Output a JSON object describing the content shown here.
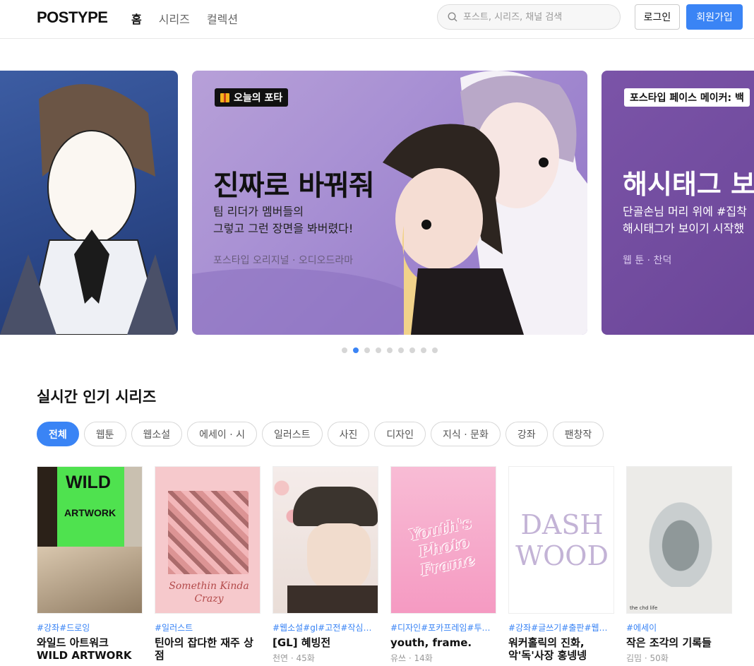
{
  "header": {
    "logo": "POSTYPE",
    "nav": [
      "홈",
      "시리즈",
      "컬렉션"
    ],
    "search_placeholder": "포스트, 시리즈, 채널 검색",
    "login": "로그인",
    "signup": "회원가입"
  },
  "carousel": {
    "main": {
      "badge": "오늘의 포타",
      "title": "진짜로 바꿔줘",
      "desc_line1": "팀 리더가 멤버들의",
      "desc_line2": "그렇고 그런 장면을 봐버렸다!",
      "meta": "포스타입 오리지널 · 오디오드라마"
    },
    "right": {
      "badge": "포스타입 페이스 메이커: 백",
      "title": "해시태그 보",
      "desc_line1": "단골손님 머리 위에 #집착",
      "desc_line2": "해시태그가 보이기 시작했",
      "meta": "웹 툰 · 찬덕"
    },
    "dots_total": 9,
    "active_index": 1
  },
  "section": {
    "title": "실시간 인기 시리즈",
    "chips": [
      "전체",
      "웹툰",
      "웹소설",
      "에세이 · 시",
      "일러스트",
      "사진",
      "디자인",
      "지식 · 문화",
      "강좌",
      "팬창작"
    ],
    "active_chip": 0
  },
  "cards": [
    {
      "tags": "#강좌#드로잉",
      "title": "와일드 아트워크 WILD ARTWORK",
      "meta": "",
      "cover_text1": "WILD",
      "cover_text2": "ARTWORK"
    },
    {
      "tags": "#일러스트",
      "title": "틴아의 잡다한 재주 상점",
      "meta": "",
      "cover_text1": "Somethin Kinda Crazy"
    },
    {
      "tags": "#웹소설#gl#고전#작심삼…",
      "title": "[GL] 혜빙전",
      "meta": "천연 · 45화"
    },
    {
      "tags": "#디자인#포카프레임#투…",
      "title": "youth, frame.",
      "meta": "유쓰 · 14화",
      "cover_text1": "Youth's Photo Frame"
    },
    {
      "tags": "#강좌#글쓰기#출판#웹소…",
      "title": "워커홀릭의 진화, 악'독'사장 홍넹넹",
      "meta": "",
      "cover_text1": "DASH WOOD"
    },
    {
      "tags": "#에세이",
      "title": "작은 조각의 기록들",
      "meta": "김밈 · 50화",
      "cover_text1": "the chd life"
    }
  ]
}
